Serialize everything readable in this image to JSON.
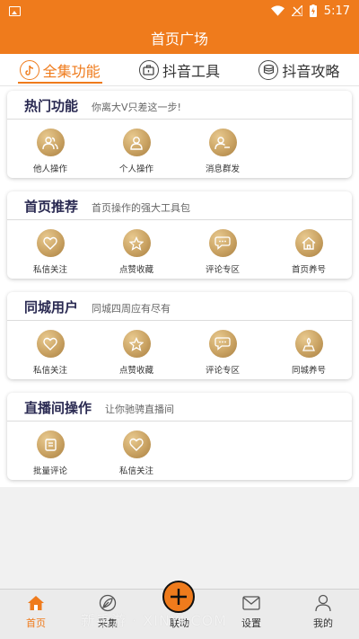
{
  "status_bar": {
    "time": "5:17"
  },
  "app_bar": {
    "title": "首页广场"
  },
  "tabs": [
    {
      "label": "全集功能",
      "icon": "douyin-logo-icon",
      "active": true
    },
    {
      "label": "抖音工具",
      "icon": "toolbox-icon",
      "active": false
    },
    {
      "label": "抖音攻略",
      "icon": "coins-icon",
      "active": false
    }
  ],
  "sections": [
    {
      "title": "热门功能",
      "subtitle": "你离大V只差这一步!",
      "items": [
        {
          "label": "他人操作",
          "icon": "users-icon"
        },
        {
          "label": "个人操作",
          "icon": "user-icon"
        },
        {
          "label": "消息群发",
          "icon": "user-broadcast-icon"
        }
      ]
    },
    {
      "title": "首页推荐",
      "subtitle": "首页操作的强大工具包",
      "items": [
        {
          "label": "私信关注",
          "icon": "heart-icon"
        },
        {
          "label": "点赞收藏",
          "icon": "star-icon"
        },
        {
          "label": "评论专区",
          "icon": "comment-icon"
        },
        {
          "label": "首页养号",
          "icon": "home-icon"
        }
      ]
    },
    {
      "title": "同城用户",
      "subtitle": "同城四周应有尽有",
      "items": [
        {
          "label": "私信关注",
          "icon": "heart-icon"
        },
        {
          "label": "点赞收藏",
          "icon": "star-icon"
        },
        {
          "label": "评论专区",
          "icon": "comment-icon"
        },
        {
          "label": "同城养号",
          "icon": "city-icon"
        }
      ]
    },
    {
      "title": "直播间操作",
      "subtitle": "让你驰骋直播间",
      "items": [
        {
          "label": "批量评论",
          "icon": "batch-comment-icon"
        },
        {
          "label": "私信关注",
          "icon": "heart-icon"
        }
      ]
    }
  ],
  "bottom_nav": [
    {
      "label": "首页",
      "icon": "home-icon",
      "active": true
    },
    {
      "label": "采集",
      "icon": "leaf-icon",
      "active": false
    },
    {
      "label": "联动",
      "icon": "plus-icon",
      "active": false
    },
    {
      "label": "设置",
      "icon": "mail-icon",
      "active": false
    },
    {
      "label": "我的",
      "icon": "person-icon",
      "active": false
    }
  ],
  "watermark": "新手游 · XINYI.COM",
  "colors": {
    "accent": "#ef7b1c",
    "gold": "#c9a262",
    "title_text": "#2a2a52"
  }
}
